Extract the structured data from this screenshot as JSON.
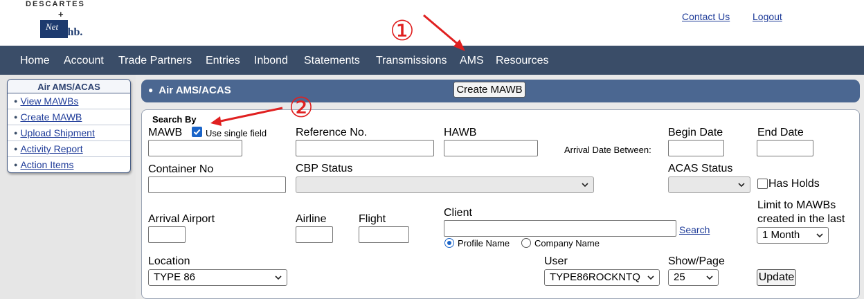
{
  "logo": {
    "top": "DESCARTES",
    "plus": "+",
    "net": "Net",
    "chb": "Chb."
  },
  "top_links": {
    "contact": "Contact Us",
    "logout": "Logout"
  },
  "nav": [
    "Home",
    "Account",
    "Trade Partners",
    "Entries",
    "Inbond",
    "Statements",
    "Transmissions",
    "AMS",
    "Resources"
  ],
  "annotations": {
    "one": "①",
    "two": "②",
    "color": "#e02020"
  },
  "sidebar": {
    "title": "Air AMS/ACAS",
    "items": [
      "View MAWBs",
      "Create MAWB",
      "Upload Shipment",
      "Activity Report",
      "Action Items"
    ]
  },
  "header": {
    "bullet": "●",
    "title": "Air AMS/ACAS",
    "create_button": "Create MAWB"
  },
  "search": {
    "legend": "Search By",
    "mawb_label": "MAWB",
    "single_field_label": "Use single field",
    "single_field_checked": true,
    "reference_label": "Reference No.",
    "hawb_label": "HAWB",
    "arrival_between_label": "Arrival Date Between:",
    "begin_date_label": "Begin Date",
    "end_date_label": "End Date",
    "container_label": "Container No",
    "cbp_status_label": "CBP Status",
    "cbp_status_value": "",
    "acas_status_label": "ACAS Status",
    "acas_status_value": "",
    "has_holds_label": "Has Holds",
    "has_holds_checked": false,
    "arrival_airport_label": "Arrival Airport",
    "airline_label": "Airline",
    "flight_label": "Flight",
    "client_label": "Client",
    "client_search_link": "Search",
    "profile_name_label": "Profile Name",
    "company_name_label": "Company Name",
    "client_mode_selected": "Profile Name",
    "limit_label_1": "Limit to MAWBs",
    "limit_label_2": "created in the last",
    "limit_value": "1 Month",
    "location_label": "Location",
    "location_value": "TYPE 86",
    "user_label": "User",
    "user_value": "TYPE86ROCKNTQ",
    "show_page_label": "Show/Page",
    "show_page_value": "25",
    "update_button": "Update"
  },
  "colors": {
    "navbar": "#3a4d68",
    "header_bar": "#4b6791",
    "link": "#1f3c99",
    "checkbox": "#1a64c8"
  },
  "icons": [
    "chevron-down-icon",
    "checkbox-checked-icon",
    "checkbox-unchecked-icon",
    "radio-selected-icon",
    "radio-unselected-icon",
    "arrow-annotation-icon"
  ]
}
